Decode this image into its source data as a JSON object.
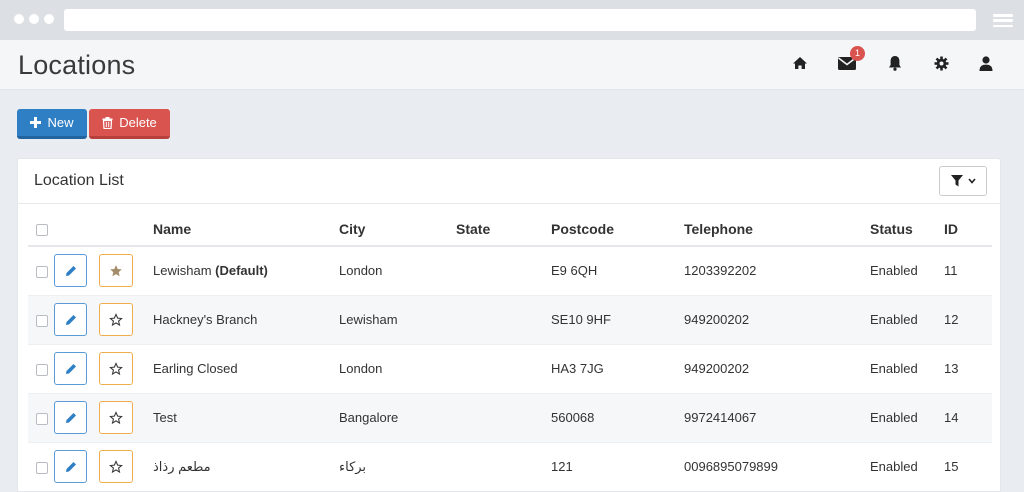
{
  "header": {
    "title": "Locations",
    "notification_count": "1"
  },
  "header_icons": [
    "home-icon",
    "envelope-icon",
    "bell-icon",
    "gear-icon",
    "user-icon"
  ],
  "toolbar": {
    "new_label": "New",
    "delete_label": "Delete"
  },
  "panel": {
    "title": "Location List"
  },
  "table": {
    "columns": {
      "name": "Name",
      "city": "City",
      "state": "State",
      "postcode": "Postcode",
      "telephone": "Telephone",
      "status": "Status",
      "id": "ID"
    },
    "rows": [
      {
        "name": "Lewisham",
        "name_suffix": "(Default)",
        "favorite": true,
        "city": "London",
        "state": "",
        "postcode": "E9 6QH",
        "telephone": "1203392202",
        "status": "Enabled",
        "id": "11"
      },
      {
        "name": "Hackney's Branch",
        "name_suffix": "",
        "favorite": false,
        "city": "Lewisham",
        "state": "",
        "postcode": "SE10 9HF",
        "telephone": "949200202",
        "status": "Enabled",
        "id": "12"
      },
      {
        "name": "Earling Closed",
        "name_suffix": "",
        "favorite": false,
        "city": "London",
        "state": "",
        "postcode": "HA3 7JG",
        "telephone": "949200202",
        "status": "Enabled",
        "id": "13"
      },
      {
        "name": "Test",
        "name_suffix": "",
        "favorite": false,
        "city": "Bangalore",
        "state": "",
        "postcode": "560068",
        "telephone": "9972414067",
        "status": "Enabled",
        "id": "14"
      },
      {
        "name": "مطعم رذاذ",
        "name_suffix": "",
        "favorite": false,
        "city": "بركاء",
        "state": "",
        "postcode": "121",
        "telephone": "0096895079899",
        "status": "Enabled",
        "id": "15"
      }
    ]
  },
  "colors": {
    "primary": "#2f7fc5",
    "danger": "#d9534f",
    "warning": "#f0ad4e",
    "header_bg": "#f5f6f8",
    "page_bg": "#e9ecf1"
  }
}
